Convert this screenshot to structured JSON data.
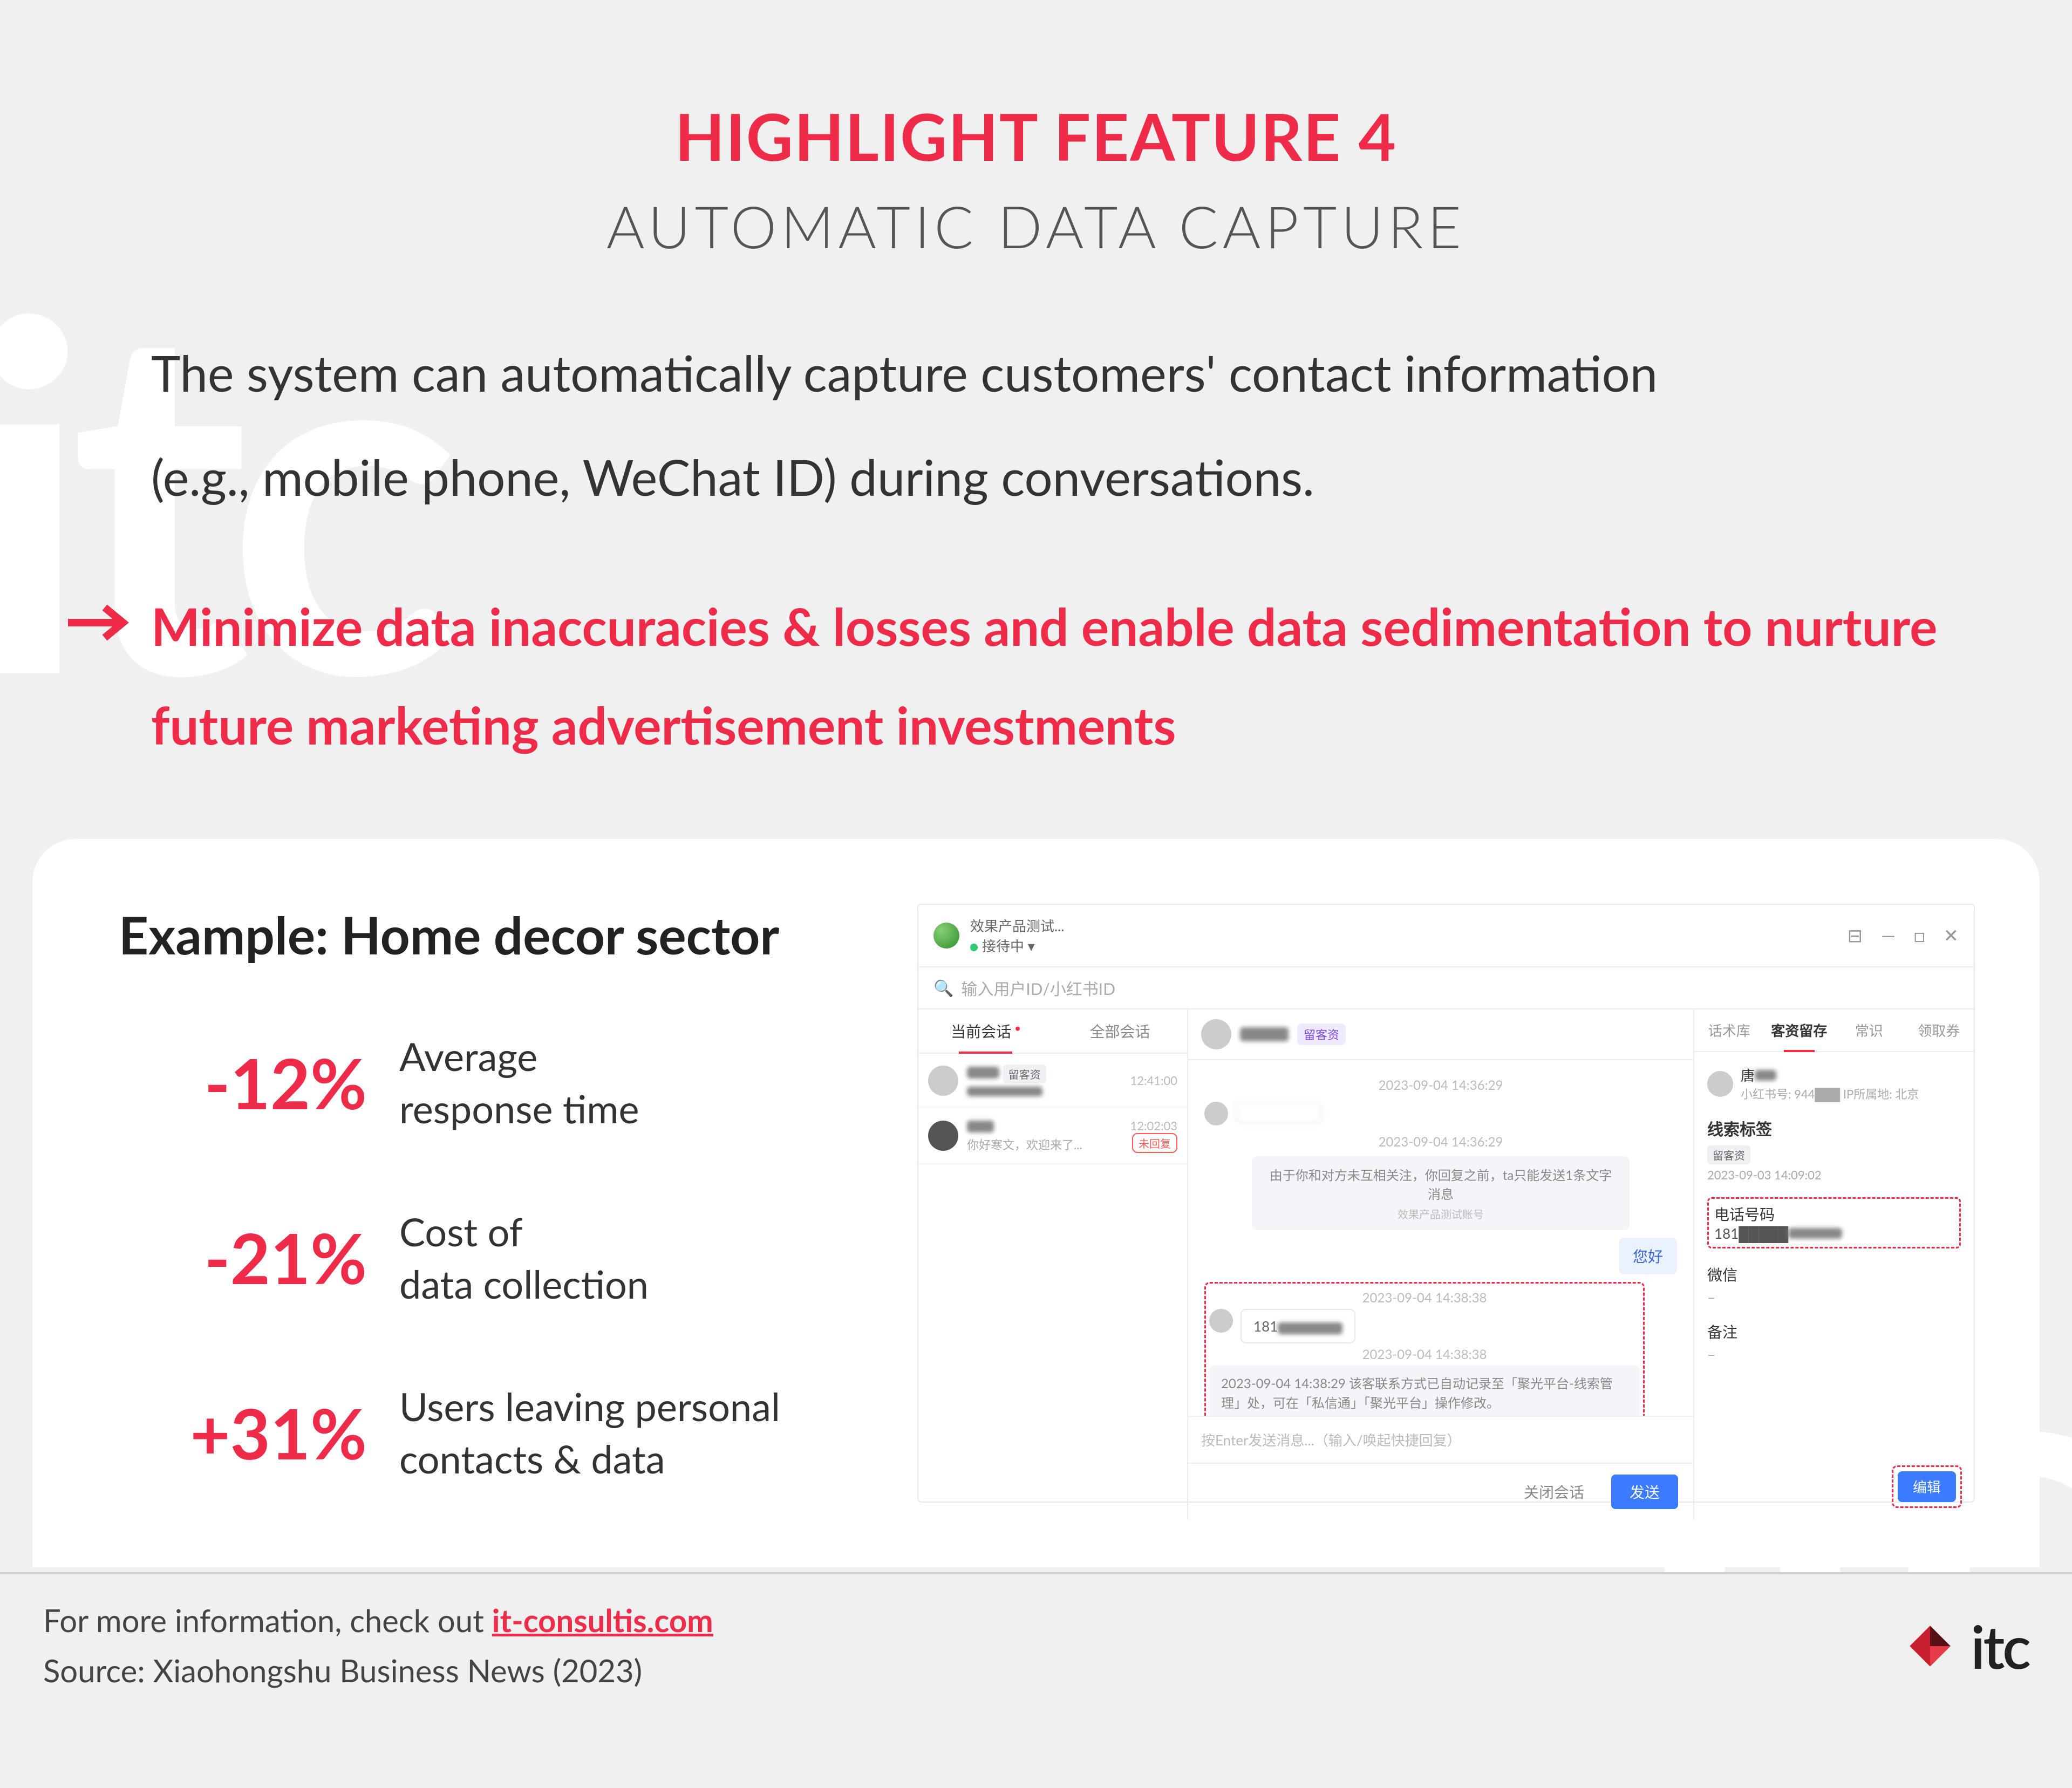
{
  "header": {
    "title": "HIGHLIGHT FEATURE 4",
    "subtitle": "AUTOMATIC DATA CAPTURE"
  },
  "body_line1": "The system can automatically capture customers' contact information",
  "body_line2": "(e.g., mobile phone, WeChat ID) during conversations.",
  "callout": "Minimize data inaccuracies & losses and enable data sedimentation to nurture future marketing advertisement investments",
  "example": {
    "title": "Example: Home decor sector",
    "stats": [
      {
        "value": "-12%",
        "label_l1": "Average",
        "label_l2": "response time"
      },
      {
        "value": "-21%",
        "label_l1": "Cost of",
        "label_l2": "data collection"
      },
      {
        "value": "+31%",
        "label_l1": "Users leaving personal",
        "label_l2": "contacts & data"
      }
    ]
  },
  "app": {
    "title": "效果产品测试...",
    "status": "接待中",
    "search_placeholder": "输入用户ID/小红书ID",
    "left_tabs": {
      "current": "当前会话",
      "all": "全部会话"
    },
    "window_icons": {
      "help": "⊟",
      "min": "—",
      "max": "□",
      "close": "✕"
    },
    "conv1": {
      "badge": "留客资",
      "time": "12:41:00"
    },
    "conv2": {
      "sub": "你好寒文，欢迎来了...",
      "badge": "未回复",
      "time": "12:02:03"
    },
    "chat": {
      "head_badge": "留客资",
      "ts1": "2023-09-04 14:36:29",
      "ts2": "2023-09-04 14:36:29",
      "sys1": "由于你和对方未互相关注，你回复之前，ta只能发送1条文字消息",
      "sys1_sub": "效果产品测试账号",
      "out1": "您好",
      "ts3": "2023-09-04 14:38:38",
      "in_phone": "181",
      "ts4": "2023-09-04 14:38:38",
      "sys2": "2023-09-04 14:38:29 该客联系方式已自动记录至「聚光平台-线索管理」处，可在「私信通」「聚光平台」操作修改。",
      "input_placeholder": "按Enter发送消息...（输入/唤起快捷回复）",
      "btn_close": "关闭会话",
      "btn_send": "发送"
    },
    "right": {
      "tabs": {
        "t1": "话术库",
        "t2": "客资留存",
        "t3": "常识",
        "t4": "领取券"
      },
      "user_line": "小红书号: 944███   IP所属地: 北京",
      "sec_title": "线索标签",
      "sec_badge": "留客资",
      "sec_sub": "2023-09-03 14:09:02",
      "field_phone": "电话号码",
      "field_phone_val": "181█████",
      "field_wechat": "微信",
      "field_note": "备注",
      "dash": "–",
      "btn_edit": "编辑"
    }
  },
  "footer": {
    "line1_pre": "For more information, check out ",
    "link": "it-consultis.com",
    "line2": "Source:  Xiaohongshu Business News (2023)",
    "logo": "itc"
  }
}
